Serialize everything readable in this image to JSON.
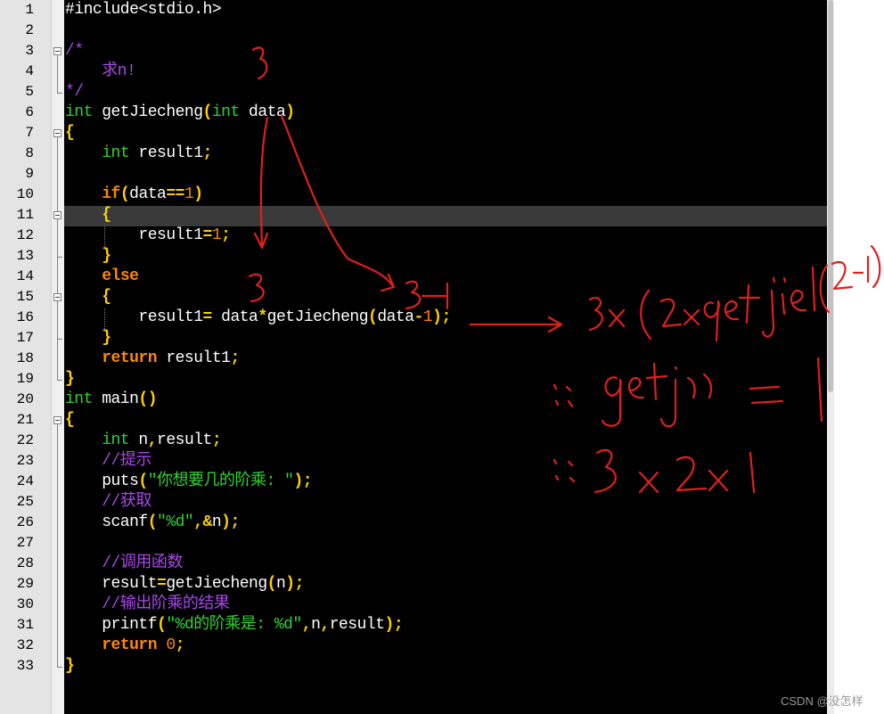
{
  "editor": {
    "lines": [
      {
        "n": "1",
        "t": [
          [
            "pl",
            "#include<stdio.h>"
          ]
        ]
      },
      {
        "n": "2",
        "t": []
      },
      {
        "n": "3",
        "t": [
          [
            "cmt",
            "/*"
          ]
        ]
      },
      {
        "n": "4",
        "t": [
          [
            "cmt",
            "    求n!"
          ]
        ]
      },
      {
        "n": "5",
        "t": [
          [
            "cmt",
            "*/"
          ]
        ]
      },
      {
        "n": "6",
        "t": [
          [
            "kw",
            "int"
          ],
          [
            "pl",
            " getJiecheng"
          ],
          [
            "op",
            "("
          ],
          [
            "kw",
            "int"
          ],
          [
            "pl",
            " data"
          ],
          [
            "op",
            ")"
          ]
        ]
      },
      {
        "n": "7",
        "t": [
          [
            "op",
            "{"
          ]
        ]
      },
      {
        "n": "8",
        "t": [
          [
            "pl",
            "    "
          ],
          [
            "kw",
            "int"
          ],
          [
            "pl",
            " result1"
          ],
          [
            "op",
            ";"
          ]
        ]
      },
      {
        "n": "9",
        "t": []
      },
      {
        "n": "10",
        "t": [
          [
            "pl",
            "    "
          ],
          [
            "kw2",
            "if"
          ],
          [
            "op",
            "("
          ],
          [
            "pl",
            "data"
          ],
          [
            "op",
            "=="
          ],
          [
            "num",
            "1"
          ],
          [
            "op",
            ")"
          ]
        ]
      },
      {
        "n": "11",
        "t": [
          [
            "pl",
            "    "
          ],
          [
            "op",
            "{"
          ]
        ]
      },
      {
        "n": "12",
        "t": [
          [
            "pl",
            "        result1"
          ],
          [
            "op",
            "="
          ],
          [
            "num",
            "1"
          ],
          [
            "op",
            ";"
          ]
        ]
      },
      {
        "n": "13",
        "t": [
          [
            "pl",
            "    "
          ],
          [
            "op",
            "}"
          ]
        ]
      },
      {
        "n": "14",
        "t": [
          [
            "pl",
            "    "
          ],
          [
            "kw2",
            "else"
          ]
        ]
      },
      {
        "n": "15",
        "t": [
          [
            "pl",
            "    "
          ],
          [
            "op",
            "{"
          ]
        ]
      },
      {
        "n": "16",
        "t": [
          [
            "pl",
            "        result1"
          ],
          [
            "op",
            "="
          ],
          [
            "pl",
            " data"
          ],
          [
            "op",
            "*"
          ],
          [
            "pl",
            "getJiecheng"
          ],
          [
            "op",
            "("
          ],
          [
            "pl",
            "data"
          ],
          [
            "op",
            "-"
          ],
          [
            "num",
            "1"
          ],
          [
            "op",
            ");"
          ]
        ]
      },
      {
        "n": "17",
        "t": [
          [
            "pl",
            "    "
          ],
          [
            "op",
            "}"
          ]
        ]
      },
      {
        "n": "18",
        "t": [
          [
            "pl",
            "    "
          ],
          [
            "kw2",
            "return"
          ],
          [
            "pl",
            " result1"
          ],
          [
            "op",
            ";"
          ]
        ]
      },
      {
        "n": "19",
        "t": [
          [
            "op",
            "}"
          ]
        ]
      },
      {
        "n": "20",
        "t": [
          [
            "kw",
            "int"
          ],
          [
            "pl",
            " main"
          ],
          [
            "op",
            "()"
          ]
        ]
      },
      {
        "n": "21",
        "t": [
          [
            "op",
            "{"
          ]
        ]
      },
      {
        "n": "22",
        "t": [
          [
            "pl",
            "    "
          ],
          [
            "kw",
            "int"
          ],
          [
            "pl",
            " n"
          ],
          [
            "op",
            ","
          ],
          [
            "pl",
            "result"
          ],
          [
            "op",
            ";"
          ]
        ]
      },
      {
        "n": "23",
        "t": [
          [
            "pl",
            "    "
          ],
          [
            "cmt",
            "//提示"
          ]
        ]
      },
      {
        "n": "24",
        "t": [
          [
            "pl",
            "    puts"
          ],
          [
            "op",
            "("
          ],
          [
            "str",
            "\"你想要几的阶乘: \""
          ],
          [
            "op",
            ");"
          ]
        ]
      },
      {
        "n": "25",
        "t": [
          [
            "pl",
            "    "
          ],
          [
            "cmt",
            "//获取"
          ]
        ]
      },
      {
        "n": "26",
        "t": [
          [
            "pl",
            "    scanf"
          ],
          [
            "op",
            "("
          ],
          [
            "str",
            "\"%d\""
          ],
          [
            "op",
            ",&"
          ],
          [
            "pl",
            "n"
          ],
          [
            "op",
            ");"
          ]
        ]
      },
      {
        "n": "27",
        "t": []
      },
      {
        "n": "28",
        "t": [
          [
            "pl",
            "    "
          ],
          [
            "cmt",
            "//调用函数"
          ]
        ]
      },
      {
        "n": "29",
        "t": [
          [
            "pl",
            "    result"
          ],
          [
            "op",
            "="
          ],
          [
            "pl",
            "getJiecheng"
          ],
          [
            "op",
            "("
          ],
          [
            "pl",
            "n"
          ],
          [
            "op",
            ");"
          ]
        ]
      },
      {
        "n": "30",
        "t": [
          [
            "pl",
            "    "
          ],
          [
            "cmt",
            "//输出阶乘的结果"
          ]
        ]
      },
      {
        "n": "31",
        "t": [
          [
            "pl",
            "    printf"
          ],
          [
            "op",
            "("
          ],
          [
            "str",
            "\"%d的阶乘是: %d\""
          ],
          [
            "op",
            ","
          ],
          [
            "pl",
            "n"
          ],
          [
            "op",
            ","
          ],
          [
            "pl",
            "result"
          ],
          [
            "op",
            ");"
          ]
        ]
      },
      {
        "n": "32",
        "t": [
          [
            "pl",
            "    "
          ],
          [
            "kw2",
            "return"
          ],
          [
            "pl",
            " "
          ],
          [
            "num",
            "0"
          ],
          [
            "op",
            ";"
          ]
        ]
      },
      {
        "n": "33",
        "t": [
          [
            "op",
            "}"
          ]
        ]
      }
    ],
    "current_line": 11
  },
  "watermark": "CSDN @没怎样",
  "colors": {
    "keyword_type": "#2fd42f",
    "keyword_flow": "#ff8800",
    "number": "#ff8800",
    "string": "#2fd42f",
    "comment": "#a848e8",
    "operator": "#ffd000",
    "plain": "#ffffff",
    "ink": "#e0201a"
  }
}
